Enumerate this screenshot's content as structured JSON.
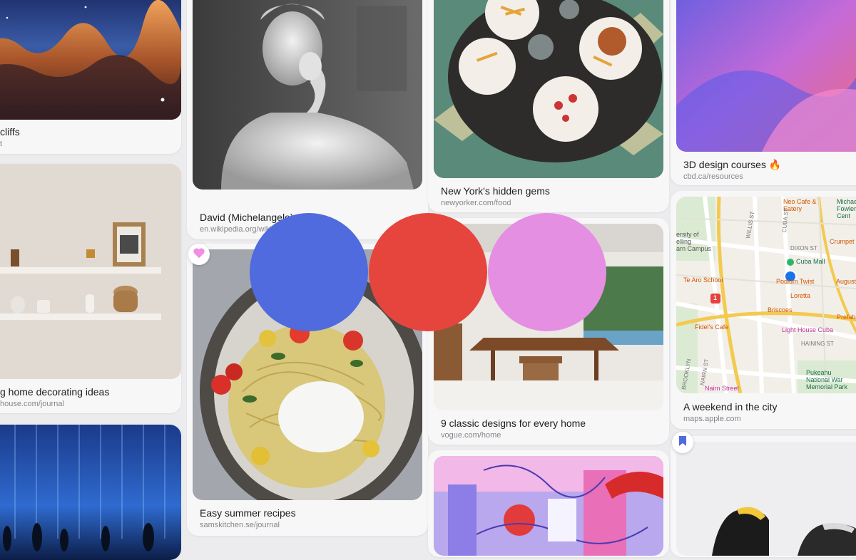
{
  "cards": [
    {
      "title": "cliffs",
      "source": "t"
    },
    {
      "title": "g home decorating ideas",
      "source": "house.com/journal"
    },
    {
      "title": "David (Michelangelo)",
      "source": "en.wikipedia.org/wiki"
    },
    {
      "title": "Easy summer recipes",
      "source": "samskitchen.se/journal"
    },
    {
      "title": "New York's hidden gems",
      "source": "newyorker.com/food"
    },
    {
      "title": "9 classic designs for every home",
      "source": "vogue.com/home"
    },
    {
      "title": "3D design courses 🔥",
      "source": "cbd.ca/resources"
    },
    {
      "title": "A weekend in the city",
      "source": "maps.apple.com"
    }
  ],
  "map_labels": {
    "neo_cafe": "Neo Cafe &",
    "eatery": "Eatery",
    "michael_fowler": "Michael",
    "fowler_centre": "Fowler Cent",
    "crumpet": "Crumpet",
    "cuba_mall": "Cuba Mall",
    "podium_twist": "Podium Twist",
    "august": "August E",
    "te_aro_school": "Te Aro School",
    "loretta": "Loretta",
    "briscoes": "Briscoes",
    "prefab": "Prefab",
    "fidels_cafe": "Fidel's Cafe",
    "light_house_cuba": "Light House Cuba",
    "nairn_street": "Nairn Street",
    "pukeahu": "Pukeahu",
    "national_war": "National War",
    "memorial_park": "Memorial Park",
    "willis_st": "WILLIS ST",
    "cuba_st": "CUBA ST",
    "dixon_st": "DIXON ST",
    "haining_st": "HAINING ST",
    "brooklyn": "BROOKLYN",
    "nairn_st": "NAIRN ST",
    "university": "ersity of",
    "welling": "elling",
    "campus": "arn Campus",
    "road_badge": "1"
  },
  "icons": {
    "heart": "heart-icon",
    "bookmark": "bookmark-icon"
  },
  "colors": {
    "accent_blue": "#4f6bde",
    "accent_red": "#e5453d",
    "accent_pink": "#e58fe3",
    "background": "#ececef"
  }
}
